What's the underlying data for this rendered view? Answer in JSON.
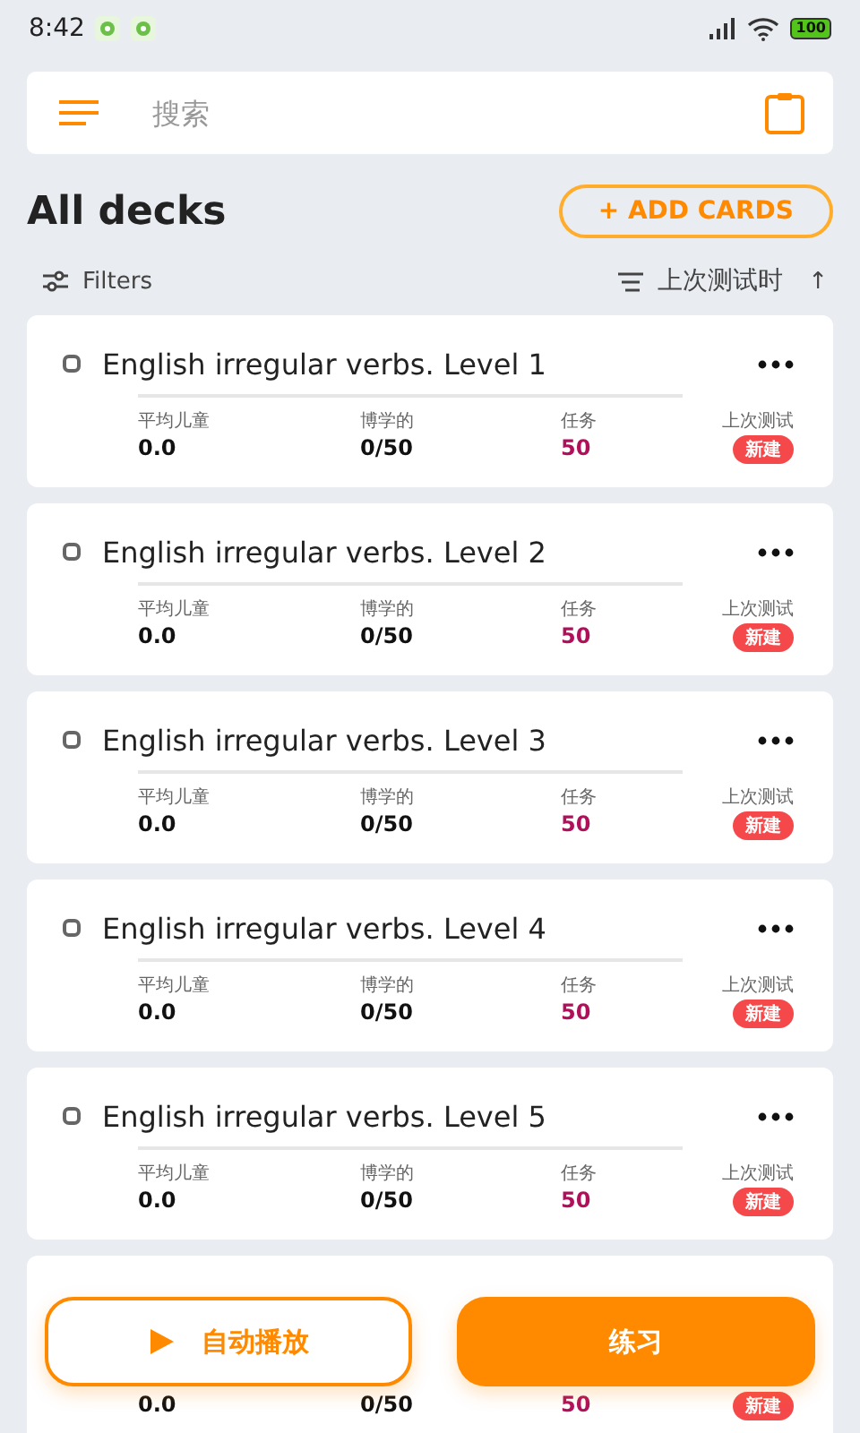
{
  "status_bar": {
    "time": "8:42",
    "battery": "100"
  },
  "search": {
    "placeholder": "搜索"
  },
  "header": {
    "title": "All decks",
    "add_button": "+ ADD CARDS"
  },
  "filters": {
    "label": "Filters",
    "sort_label": "上次测试时",
    "sort_arrow": "↑"
  },
  "decks": [
    {
      "kind": "full",
      "checked": false,
      "title": "English irregular verbs. Level 1",
      "stats": [
        {
          "label": "平均儿童",
          "value": "0.0"
        },
        {
          "label": "博学的",
          "value": "0/50"
        },
        {
          "label": "任务",
          "value": "50"
        },
        {
          "label": "上次测试",
          "value": "新建"
        }
      ]
    },
    {
      "kind": "full",
      "checked": false,
      "title": "English irregular verbs. Level 2",
      "stats": [
        {
          "label": "平均儿童",
          "value": "0.0"
        },
        {
          "label": "博学的",
          "value": "0/50"
        },
        {
          "label": "任务",
          "value": "50"
        },
        {
          "label": "上次测试",
          "value": "新建"
        }
      ]
    },
    {
      "kind": "full",
      "checked": false,
      "title": "English irregular verbs. Level 3",
      "stats": [
        {
          "label": "平均儿童",
          "value": "0.0"
        },
        {
          "label": "博学的",
          "value": "0/50"
        },
        {
          "label": "任务",
          "value": "50"
        },
        {
          "label": "上次测试",
          "value": "新建"
        }
      ]
    },
    {
      "kind": "full",
      "checked": false,
      "title": "English irregular verbs. Level 4",
      "stats": [
        {
          "label": "平均儿童",
          "value": "0.0"
        },
        {
          "label": "博学的",
          "value": "0/50"
        },
        {
          "label": "任务",
          "value": "50"
        },
        {
          "label": "上次测试",
          "value": "新建"
        }
      ]
    },
    {
      "kind": "full",
      "checked": false,
      "title": "English irregular verbs. Level 5",
      "stats": [
        {
          "label": "平均儿童",
          "value": "0.0"
        },
        {
          "label": "博学的",
          "value": "0/50"
        },
        {
          "label": "任务",
          "value": "50"
        },
        {
          "label": "上次测试",
          "value": "新建"
        }
      ]
    },
    {
      "kind": "covered",
      "stats": [
        {
          "value": "0.0"
        },
        {
          "value": "0/50"
        },
        {
          "value": "50"
        },
        {
          "value": "新建"
        }
      ]
    }
  ],
  "bottom_buttons": {
    "autoplay": "自动播放",
    "practice": "练习"
  }
}
